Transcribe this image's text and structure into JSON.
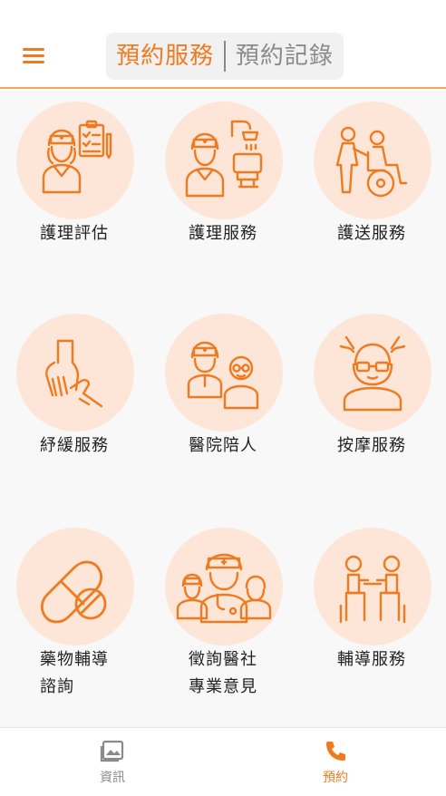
{
  "header": {
    "menu_icon": "hamburger-menu-icon",
    "tabs": [
      {
        "label": "預約服務",
        "active": true
      },
      {
        "label": "預約記錄",
        "active": false
      }
    ],
    "accent_color": "#f07a20"
  },
  "services": [
    {
      "label": "護理評估",
      "icon": "nurse-assessment-icon"
    },
    {
      "label": "護理服務",
      "icon": "nurse-shower-icon"
    },
    {
      "label": "護送服務",
      "icon": "wheelchair-escort-icon"
    },
    {
      "label": "紓緩服務",
      "icon": "hand-relief-icon"
    },
    {
      "label": "醫院陪人",
      "icon": "hospital-companion-icon"
    },
    {
      "label": "按摩服務",
      "icon": "massage-icon"
    },
    {
      "label_line1": "藥物輔導",
      "label_line2": "諮詢",
      "icon": "pill-icon"
    },
    {
      "label_line1": "徵詢醫社",
      "label_line2": "專業意見",
      "icon": "medical-team-icon"
    },
    {
      "label": "輔導服務",
      "icon": "counseling-icon"
    }
  ],
  "tabbar": {
    "items": [
      {
        "label": "資訊",
        "icon": "image-icon",
        "active": false
      },
      {
        "label": "預約",
        "icon": "phone-icon",
        "active": true
      }
    ],
    "active_color": "#f07a20",
    "inactive_color": "#8a8a8a"
  }
}
